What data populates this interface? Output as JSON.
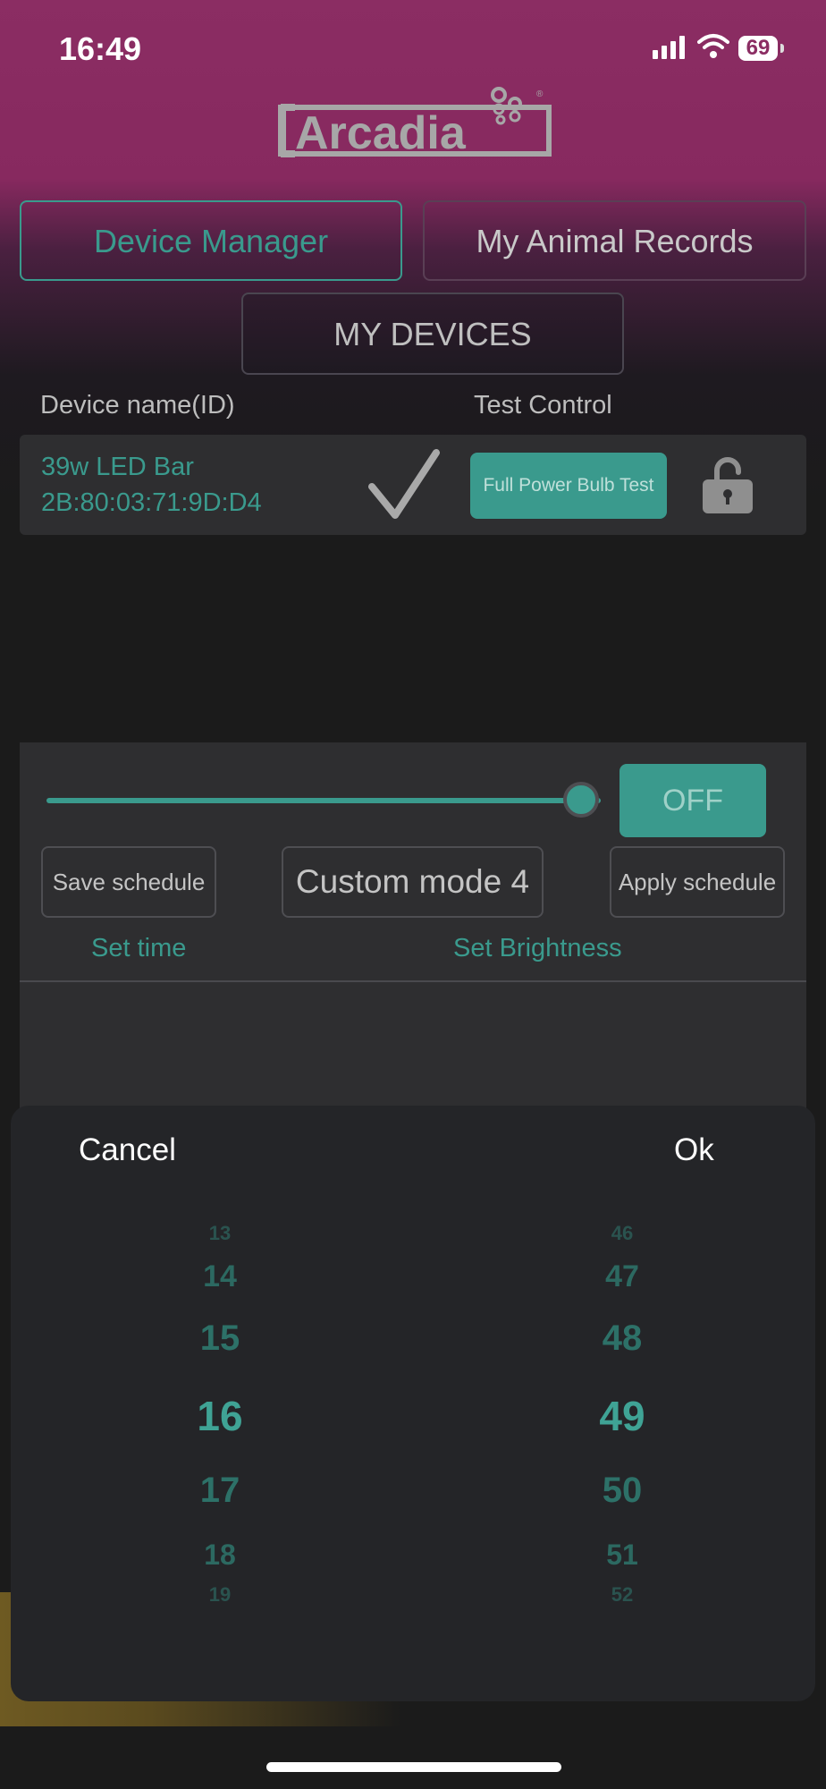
{
  "status_bar": {
    "time": "16:49",
    "battery": "69"
  },
  "brand": {
    "logo_text": "Arcadia"
  },
  "tabs": [
    {
      "label": "Device Manager",
      "active": true
    },
    {
      "label": "My Animal Records",
      "active": false
    }
  ],
  "my_devices_label": "MY DEVICES",
  "table_headers": {
    "device_name": "Device name(ID)",
    "test_control": "Test Control"
  },
  "device": {
    "name": "39w LED Bar",
    "id": "2B:80:03:71:9D:D4",
    "test_button": "Full Power Bulb Test",
    "check_icon": "checkmark-icon",
    "lock_icon": "unlock-icon"
  },
  "control_panel": {
    "brightness_level": 1.0,
    "off_label": "OFF",
    "save_label": "Save schedule",
    "mode_label": "Custom mode 4",
    "apply_label": "Apply schedule",
    "set_time_label": "Set time",
    "set_brightness_label": "Set Brightness"
  },
  "time_picker": {
    "cancel_label": "Cancel",
    "ok_label": "Ok",
    "hours": [
      "13",
      "14",
      "15",
      "16",
      "17",
      "18",
      "19"
    ],
    "minutes": [
      "46",
      "47",
      "48",
      "49",
      "50",
      "51",
      "52"
    ],
    "selected_hour": "16",
    "selected_minute": "49"
  },
  "colors": {
    "accent": "#3a9a8d",
    "header_top": "#8b2d63",
    "background": "#1b1b1b",
    "panel": "#2e2e30",
    "sheet": "#242528"
  }
}
